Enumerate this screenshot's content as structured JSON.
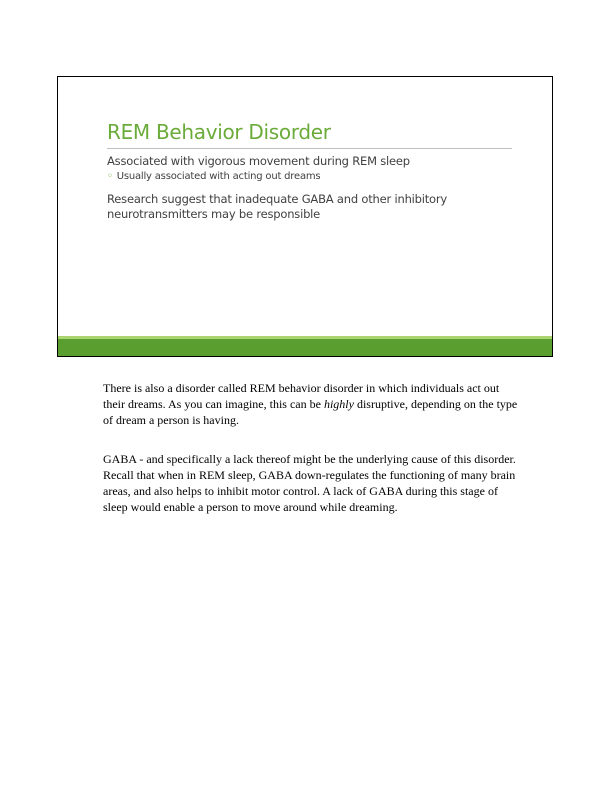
{
  "slide": {
    "title": "REM Behavior Disorder",
    "bullet1": "Associated with vigorous movement during REM sleep",
    "bullet1_sub_marker": "◦",
    "bullet1_sub": "Usually associated with acting out dreams",
    "bullet2": "Research suggest that inadequate GABA and other inhibitory neurotransmitters may be responsible",
    "accent_color": "#6aab3a",
    "bar_color": "#5a9e2f"
  },
  "notes": {
    "p1_before": "There is also a disorder called REM behavior disorder in which individuals act out their dreams. As you can imagine, this can be ",
    "p1_emph": "highly",
    "p1_after": " disruptive, depending on the type of dream a person is having.",
    "p2": "GABA - and specifically a lack thereof might be the underlying cause of this disorder. Recall that when in REM sleep, GABA down-regulates the functioning of many brain areas, and also helps to inhibit motor control. A lack of GABA during this stage of sleep would enable a person to move around while dreaming."
  }
}
